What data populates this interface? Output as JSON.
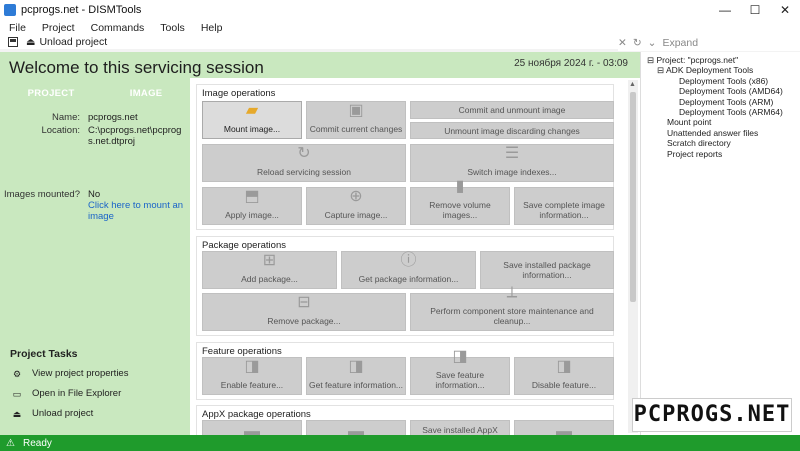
{
  "window": {
    "title": "pcprogs.net - DISMTools",
    "minimize": "—",
    "maximize": "☐",
    "close": "✕"
  },
  "menu": [
    "File",
    "Project",
    "Commands",
    "Tools",
    "Help"
  ],
  "toolbar": {
    "unload_label": "Unload project",
    "expand_label": "Expand"
  },
  "header": {
    "welcome": "Welcome to this servicing session",
    "datetime": "25 ноября 2024 г. - 03:09"
  },
  "left": {
    "tabs": [
      "PROJECT",
      "IMAGE"
    ],
    "name_label": "Name:",
    "name_value": "pcprogs.net",
    "location_label": "Location:",
    "location_value": "C:\\pcprogs.net\\pcprogs.net.dtproj",
    "mounted_label": "Images mounted?",
    "mounted_value": "No",
    "mount_link": "Click here to mount an image",
    "tasks_title": "Project Tasks",
    "tasks": [
      "View project properties",
      "Open in File Explorer",
      "Unload project"
    ]
  },
  "groups": {
    "image_ops": {
      "title": "Image operations",
      "mount": "Mount image...",
      "commit_changes": "Commit current changes",
      "commit_unmount": "Commit and unmount image",
      "unmount_discard": "Unmount image discarding changes",
      "reload": "Reload servicing session",
      "switch_index": "Switch image indexes...",
      "apply": "Apply image...",
      "capture": "Capture image...",
      "remove_volume": "Remove volume images...",
      "save_info": "Save complete image information..."
    },
    "package_ops": {
      "title": "Package operations",
      "add": "Add package...",
      "get_info": "Get package information...",
      "save_installed": "Save installed package information...",
      "remove": "Remove package...",
      "cleanup": "Perform component store maintenance and cleanup..."
    },
    "feature_ops": {
      "title": "Feature operations",
      "enable": "Enable feature...",
      "get_info": "Get feature information...",
      "save_info": "Save feature information...",
      "disable": "Disable feature..."
    },
    "appx_ops": {
      "title": "AppX package operations",
      "save_installed": "Save installed AppX package..."
    }
  },
  "tree": {
    "root": "Project: \"pcprogs.net\"",
    "adk": "ADK Deployment Tools",
    "adk_items": [
      "Deployment Tools (x86)",
      "Deployment Tools (AMD64)",
      "Deployment Tools (ARM)",
      "Deployment Tools (ARM64)"
    ],
    "others": [
      "Mount point",
      "Unattended answer files",
      "Scratch directory",
      "Project reports"
    ]
  },
  "watermark": "PCPROGS.NET",
  "status": {
    "text": "Ready"
  },
  "colors": {
    "green_panel": "#c9e8bf",
    "status_green": "#1f9b2c",
    "link": "#1a64c8"
  }
}
